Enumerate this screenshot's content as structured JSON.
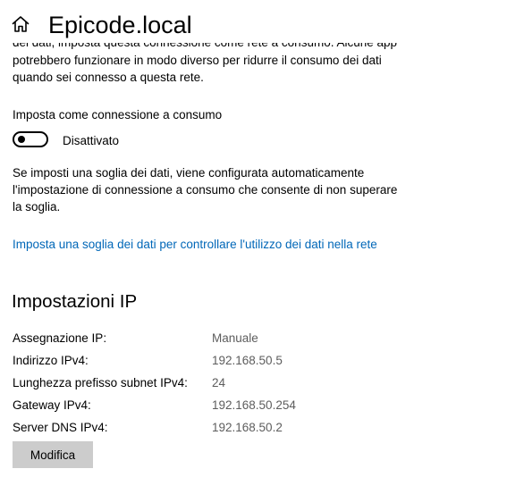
{
  "header": {
    "home_icon": "home-icon",
    "title": "Epicode.local"
  },
  "metered": {
    "description_cut_line1": "dei dati, imposta questa connessione come rete a consumo. Alcune app",
    "description_line2": "potrebbero funzionare in modo diverso per ridurre il consumo dei dati",
    "description_line3": "quando sei connesso a questa rete.",
    "toggle_label": "Imposta come connessione a consumo",
    "toggle_state": "Disattivato",
    "toggle_on": false,
    "threshold_line1": "Se imposti una soglia dei dati, viene configurata automaticamente",
    "threshold_line2": "l'impostazione di connessione a consumo che consente di non superare",
    "threshold_line3": "la soglia.",
    "threshold_link": "Imposta una soglia dei dati per controllare l'utilizzo dei dati nella rete"
  },
  "ip_settings": {
    "heading": "Impostazioni IP",
    "rows": [
      {
        "label": "Assegnazione IP:",
        "value": "Manuale"
      },
      {
        "label": "Indirizzo IPv4:",
        "value": "192.168.50.5"
      },
      {
        "label": "Lunghezza prefisso subnet IPv4:",
        "value": "24"
      },
      {
        "label": "Gateway IPv4:",
        "value": "192.168.50.254"
      },
      {
        "label": "Server DNS IPv4:",
        "value": "192.168.50.2"
      }
    ],
    "modify_button": "Modifica"
  },
  "colors": {
    "link": "#0067b8",
    "value_text": "#5d5d5d",
    "button_bg": "#cccccc"
  }
}
